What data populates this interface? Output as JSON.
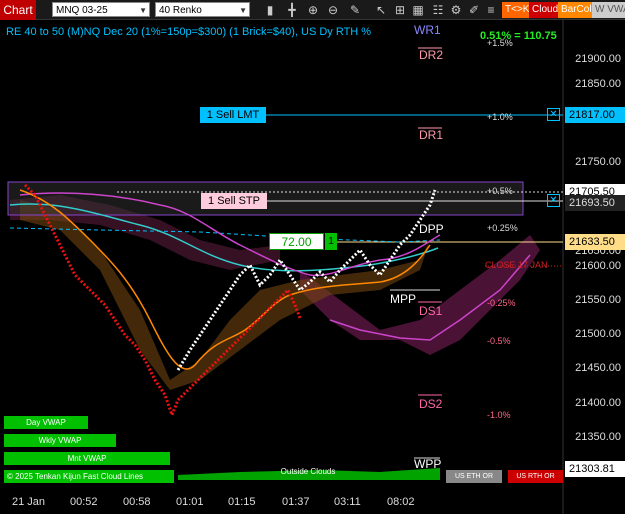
{
  "toolbar": {
    "chart_label": "Chart",
    "instrument": "MNQ 03-25",
    "bar_type": "40 Renko",
    "buttons": [
      {
        "name": "tk-button",
        "label": "T<>K",
        "color": "#ff6600"
      },
      {
        "name": "cloud-button",
        "label": "Cloud",
        "color": "#cc0000"
      },
      {
        "name": "barcol-button",
        "label": "BarCol",
        "color": "#ff8800"
      },
      {
        "name": "vwap-toolbar-button",
        "label": "W VWAI",
        "color": "#cccccc"
      }
    ],
    "icons": [
      "bar-chart-icon",
      "crosshair-icon",
      "zoom-in-icon",
      "zoom-out-icon",
      "pencil-icon",
      "pointer-icon",
      "measure-icon",
      "grid-icon",
      "properties-icon",
      "gear-icon",
      "drawing-tools-icon",
      "list-icon",
      "refresh-icon",
      "text-icon"
    ]
  },
  "header": {
    "info": "RE 40 to 50 (M)NQ Dec 20 (1%=150p=$300) (1 Brick=$40), US Dy RTH %",
    "pct_value": "0.51% = 110.75"
  },
  "price_axis": [
    "21900.00",
    "21850.00",
    "21750.00",
    "21650.00",
    "21600.00",
    "21550.00",
    "21500.00",
    "21450.00",
    "21400.00",
    "21350.00"
  ],
  "price_boxes": [
    {
      "name": "sell-lmt-price",
      "text": "21817.00",
      "bg": "#00c0ff",
      "fg": "#000000"
    },
    {
      "name": "last-price",
      "text": "21705.50",
      "bg": "#ffffff",
      "fg": "#000000"
    },
    {
      "name": "sell-stp-price",
      "text": "21693.50",
      "bg": "#222222",
      "fg": "#dddddd"
    },
    {
      "name": "dpp-price",
      "text": "21633.50",
      "bg": "#ffdd88",
      "fg": "#000000"
    },
    {
      "name": "bottom-price",
      "text": "21303.81",
      "bg": "#ffffff",
      "fg": "#000000"
    }
  ],
  "time_axis": [
    "21 Jan",
    "00:52",
    "00:58",
    "01:01",
    "01:15",
    "01:37",
    "03:11",
    "08:02"
  ],
  "levels": [
    {
      "name": "wr1-label",
      "text": "WR1",
      "color": "#8888ff"
    },
    {
      "name": "dr2-label",
      "text": "DR2",
      "color": "#ff99aa"
    },
    {
      "name": "dr1-label",
      "text": "DR1",
      "color": "#ff99aa"
    },
    {
      "name": "dpp-label",
      "text": "DPP",
      "color": "#ffffff"
    },
    {
      "name": "mpp-label",
      "text": "MPP",
      "color": "#ffffff"
    },
    {
      "name": "ds1-label",
      "text": "DS1",
      "color": "#ff66aa"
    },
    {
      "name": "ds2-label",
      "text": "DS2",
      "color": "#ff66aa"
    },
    {
      "name": "wpp-label",
      "text": "WPP",
      "color": "#ffffff"
    },
    {
      "name": "close-label",
      "text": "CLOSE 17 JAN",
      "color": "#cc2222"
    }
  ],
  "pct_levels": [
    "+1.5%",
    "+1.0%",
    "+0.5%",
    "+0.25%",
    "-0.25%",
    "-0.5%",
    "-1.0%"
  ],
  "orders": {
    "sell_lmt": "1 Sell LMT",
    "sell_stp": "1 Sell STP",
    "qty_value": "72.00",
    "qty_count": "1"
  },
  "vwap_buttons": [
    "Day VWAP",
    "Wkly VWAP",
    "Mnt VWAP"
  ],
  "bottom_bar": {
    "left_text": "© 2025 Tenkan Kijun Fast Cloud Lines",
    "outside_clouds": "Outside Clouds",
    "us_eth": "US ETH OR",
    "us_rth": "US RTH OR"
  }
}
